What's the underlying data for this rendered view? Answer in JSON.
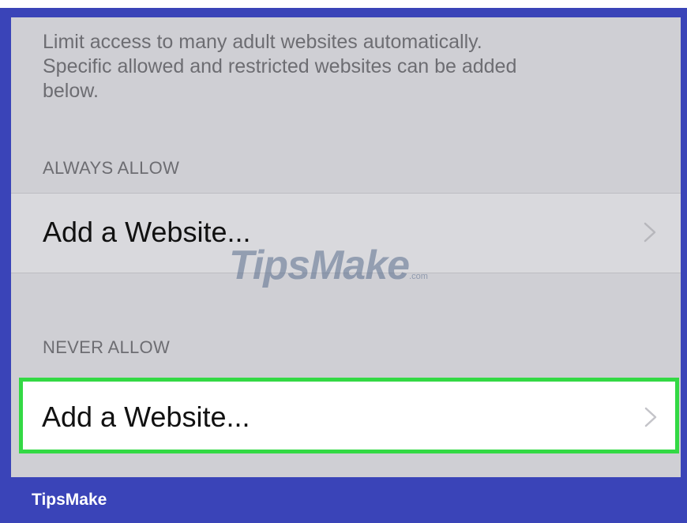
{
  "description": "Limit access to many adult websites automatically.\nSpecific allowed and restricted websites can be added\nbelow.",
  "always_allow": {
    "header": "ALWAYS ALLOW",
    "row_label": "Add a Website..."
  },
  "never_allow": {
    "header": "NEVER ALLOW",
    "row_label": "Add a Website..."
  },
  "watermark": {
    "text": "TipsMake",
    "suffix": ".com"
  },
  "footer": {
    "brand": "TipsMake"
  },
  "colors": {
    "frame_blue": "#3a44b8",
    "highlight_green": "#33d944",
    "screen_gray": "#cfcfd4"
  },
  "icons": {
    "row_chevron": "chevron-right-icon"
  }
}
